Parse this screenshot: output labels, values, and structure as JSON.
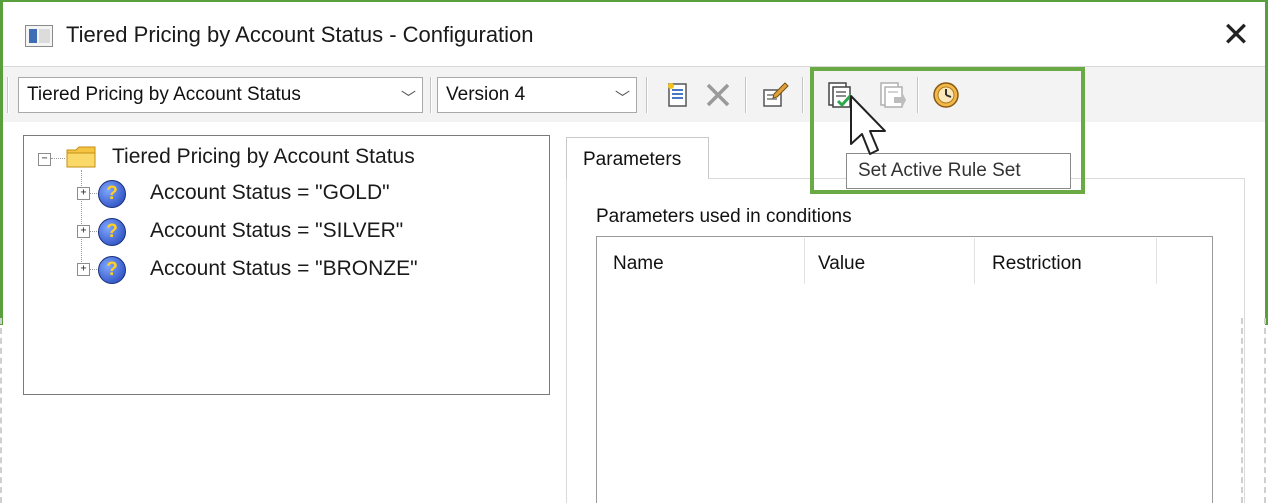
{
  "window": {
    "title": "Tiered Pricing by Account Status - Configuration"
  },
  "toolbar": {
    "ruleset_value": "Tiered Pricing by Account Status",
    "version_value": "Version 4",
    "buttons": [
      "new-rule-icon",
      "delete-icon",
      "edit-rule-icon",
      "set-active-rule-set-icon",
      "export-icon",
      "history-icon"
    ]
  },
  "tree": {
    "root_label": "Tiered Pricing by Account Status",
    "nodes": [
      {
        "label": "Account Status = \"GOLD\""
      },
      {
        "label": "Account Status = \"SILVER\""
      },
      {
        "label": "Account Status = \"BRONZE\""
      }
    ]
  },
  "tabs": {
    "parameters_label": "Parameters"
  },
  "parameters": {
    "caption": "Parameters used in conditions",
    "columns": [
      "Name",
      "Value",
      "Restriction"
    ]
  },
  "tooltip": {
    "text": "Set Active Rule Set"
  },
  "colors": {
    "callout_border": "#6aaa45",
    "window_border": "#5a9f3d"
  }
}
